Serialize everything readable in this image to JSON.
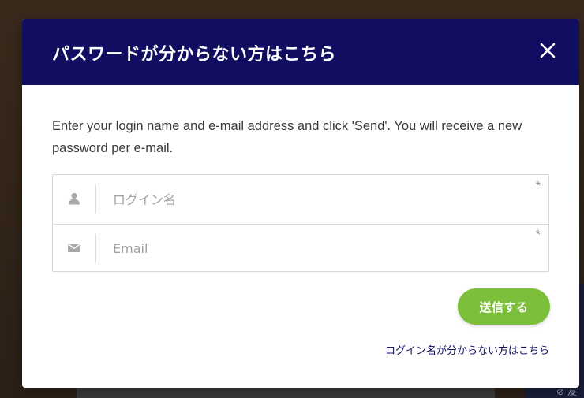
{
  "modal": {
    "title": "パスワードが分からない方はこちら",
    "description": "Enter your login name and e-mail address and click 'Send'. You will receive a new password per e-mail.",
    "fields": [
      {
        "icon": "user-icon",
        "placeholder": "ログイン名",
        "value": "",
        "required_mark": "*"
      },
      {
        "icon": "envelope-icon",
        "placeholder": "Email",
        "value": "",
        "required_mark": "*"
      }
    ],
    "send_label": "送信する",
    "forgot_login_link": "ログイン名が分からない方はこちら"
  },
  "background": {
    "partial_text": "⊘ 友"
  },
  "colors": {
    "header": "#110d61",
    "send_button": "#7cbf3a",
    "link": "#110d61"
  }
}
